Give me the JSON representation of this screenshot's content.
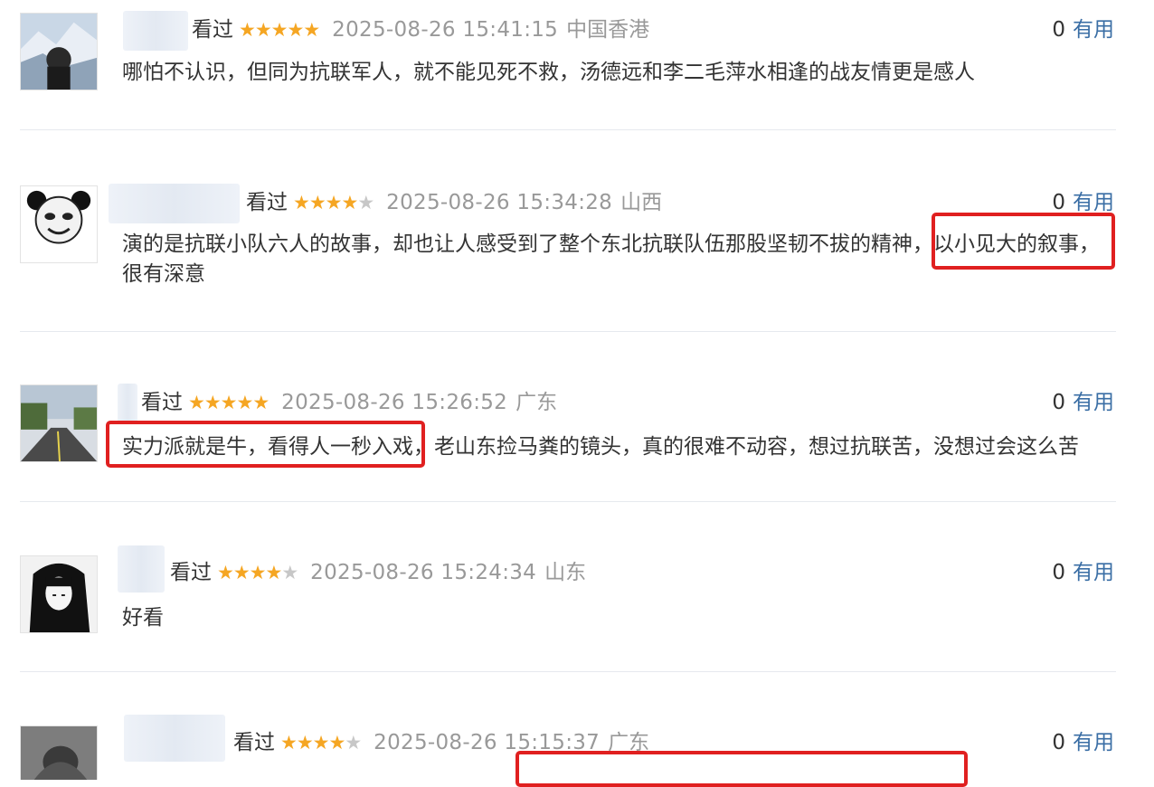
{
  "labels": {
    "seen": "看过",
    "useful": "有用"
  },
  "colors": {
    "star": "#f5a623",
    "star_off": "#c7c7c7",
    "highlight": "#e02020",
    "link": "#3a6ea5"
  },
  "comments": [
    {
      "rating": 5,
      "time": "2025-08-26 15:41:15",
      "location": "中国香港",
      "useful_count": "0",
      "text": "哪怕不认识，但同为抗联军人，就不能见死不救，汤德远和李二毛萍水相逢的战友情更是感人",
      "text2": ""
    },
    {
      "rating": 4,
      "time": "2025-08-26 15:34:28",
      "location": "山西",
      "useful_count": "0",
      "text": "演的是抗联小队六人的故事，却也让人感受到了整个东北抗联队伍那股坚韧不拔的精神，以小见大的叙事，",
      "text2": "很有深意"
    },
    {
      "rating": 5,
      "time": "2025-08-26 15:26:52",
      "location": "广东",
      "useful_count": "0",
      "text": "实力派就是牛，看得人一秒入戏，老山东捡马粪的镜头，真的很难不动容，想过抗联苦，没想过会这么苦",
      "text2": ""
    },
    {
      "rating": 4,
      "time": "2025-08-26 15:24:34",
      "location": "山东",
      "useful_count": "0",
      "text": "好看",
      "text2": ""
    },
    {
      "rating": 4,
      "time": "2025-08-26 15:15:37",
      "location": "广东",
      "useful_count": "0",
      "text": "",
      "text2": ""
    }
  ]
}
